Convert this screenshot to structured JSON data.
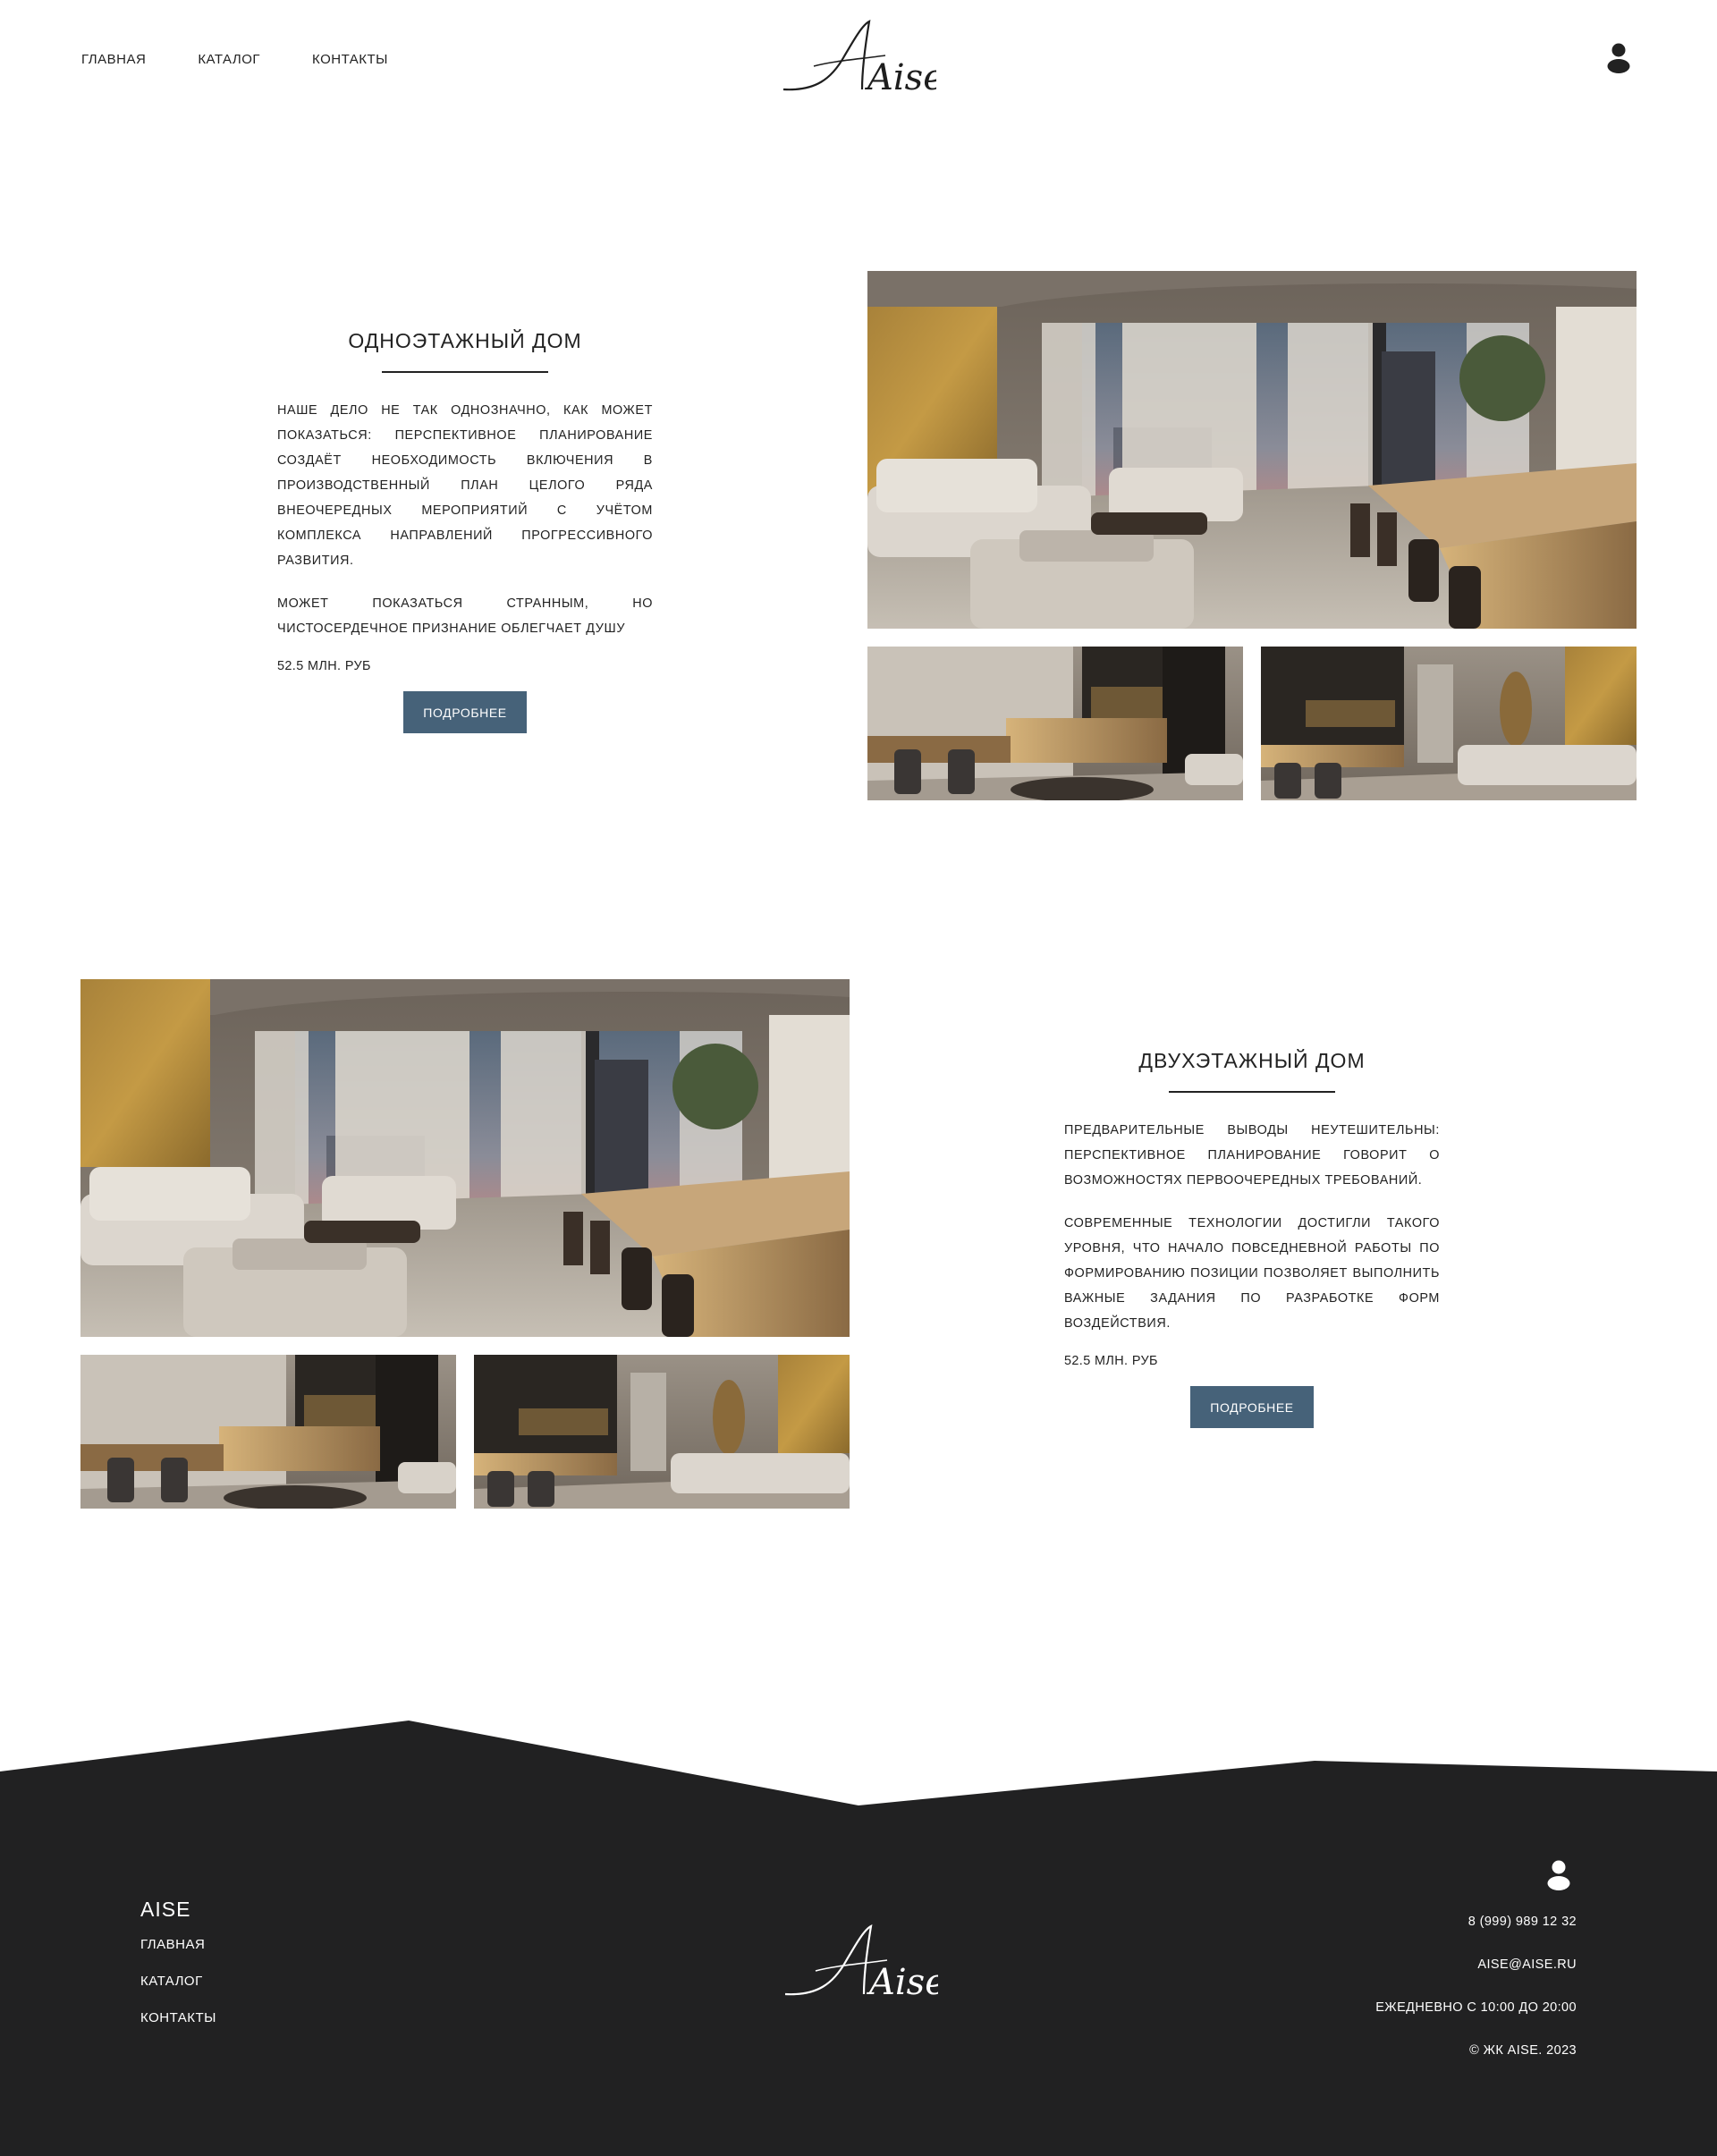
{
  "header": {
    "nav": [
      "ГЛАВНАЯ",
      "КАТАЛОГ",
      "КОНТАКТЫ"
    ],
    "logo": "Aise",
    "account_icon": "user-icon"
  },
  "properties": [
    {
      "title": "ОДНОЭТАЖНЫЙ ДОМ",
      "paragraphs": [
        "НАШЕ ДЕЛО НЕ ТАК ОДНОЗНАЧНО, КАК МОЖЕТ ПОКАЗАТЬСЯ: ПЕРСПЕКТИВНОЕ ПЛАНИРОВАНИЕ СОЗДАЁТ НЕОБХОДИМОСТЬ ВКЛЮЧЕНИЯ В ПРОИЗВОДСТВЕННЫЙ ПЛАН ЦЕЛОГО РЯДА ВНЕОЧЕРЕДНЫХ МЕРОПРИЯТИЙ С УЧЁТОМ КОМПЛЕКСА НАПРАВЛЕНИЙ ПРОГРЕССИВНОГО РАЗВИТИЯ.",
        "МОЖЕТ ПОКАЗАТЬСЯ СТРАННЫМ, НО ЧИСТОСЕРДЕЧНОЕ ПРИЗНАНИЕ ОБЛЕГЧАЕТ ДУШУ"
      ],
      "price": "52.5 МЛН. РУБ",
      "button": "ПОДРОБНЕЕ"
    },
    {
      "title": "ДВУХЭТАЖНЫЙ ДОМ",
      "paragraphs": [
        "ПРЕДВАРИТЕЛЬНЫЕ ВЫВОДЫ НЕУТЕШИТЕЛЬНЫ: ПЕРСПЕКТИВНОЕ ПЛАНИРОВАНИЕ ГОВОРИТ О ВОЗМОЖНОСТЯХ ПЕРВООЧЕРЕДНЫХ ТРЕБОВАНИЙ.",
        "СОВРЕМЕННЫЕ ТЕХНОЛОГИИ ДОСТИГЛИ ТАКОГО УРОВНЯ, ЧТО НАЧАЛО ПОВСЕДНЕВНОЙ РАБОТЫ ПО ФОРМИРОВАНИЮ ПОЗИЦИИ ПОЗВОЛЯЕТ ВЫПОЛНИТЬ ВАЖНЫЕ ЗАДАНИЯ ПО РАЗРАБОТКЕ ФОРМ ВОЗДЕЙСТВИЯ."
      ],
      "price": "52.5 МЛН. РУБ",
      "button": "ПОДРОБНЕЕ"
    }
  ],
  "footer": {
    "brand": "AISE",
    "nav": [
      "ГЛАВНАЯ",
      "КАТАЛОГ",
      "КОНТАКТЫ"
    ],
    "logo": "Aise",
    "phone": "8 (999) 989 12 32",
    "email": "AISE@AISE.RU",
    "hours": "ЕЖЕДНЕВНО С 10:00 ДО 20:00",
    "copyright": "© ЖК AISE. 2023"
  },
  "colors": {
    "accent_button": "#466279",
    "footer_bg": "#212122",
    "text": "#222222"
  }
}
